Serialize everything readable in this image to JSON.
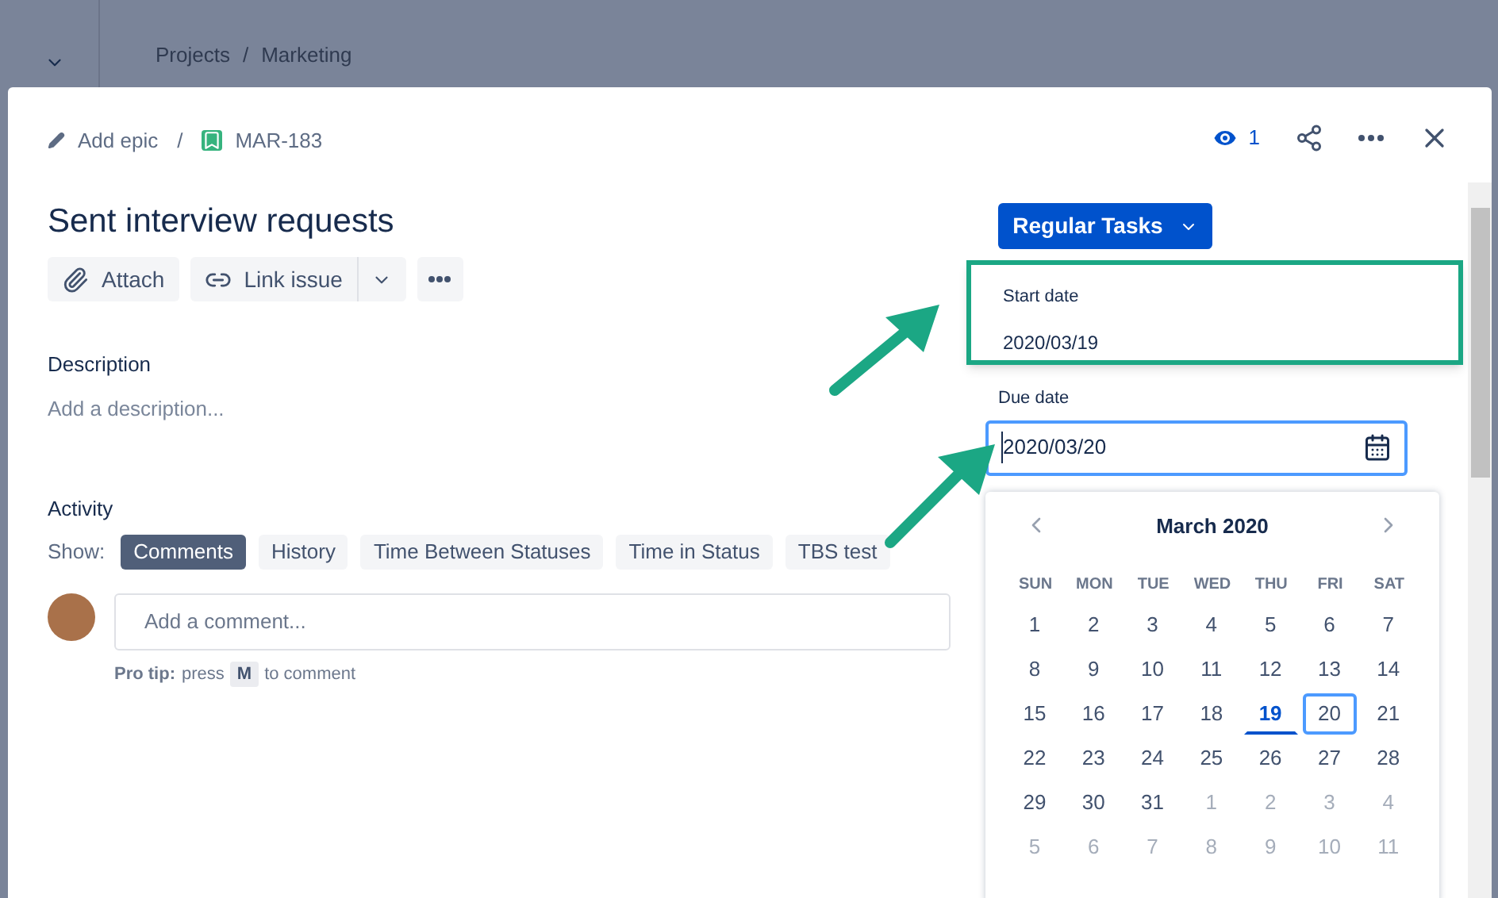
{
  "background": {
    "breadcrumb": [
      "Projects",
      "Marketing"
    ],
    "separator": "/"
  },
  "header": {
    "epic": "Add epic",
    "separator": "/",
    "issue_key": "MAR-183",
    "watchers": "1"
  },
  "issue": {
    "title": "Sent interview requests",
    "actions": [
      "Attach",
      "Link issue"
    ]
  },
  "description": {
    "label": "Description",
    "placeholder": "Add a description..."
  },
  "activity": {
    "label": "Activity",
    "show_label": "Show:",
    "tabs": [
      {
        "label": "Comments",
        "selected": true
      },
      {
        "label": "History",
        "selected": false
      },
      {
        "label": "Time Between Statuses",
        "selected": false
      },
      {
        "label": "Time in Status",
        "selected": false
      },
      {
        "label": "TBS test",
        "selected": false
      }
    ],
    "comment_placeholder": "Add a comment...",
    "tip_label": "Pro tip:",
    "tip_before": "press",
    "tip_key": "M",
    "tip_after": "to comment"
  },
  "status_button": "Regular Tasks",
  "start_date": {
    "label": "Start date",
    "value": "2020/03/19",
    "highlighted": true
  },
  "due_date": {
    "label": "Due date",
    "value": "2020/03/20"
  },
  "calendar": {
    "month": "March 2020",
    "weekdays": [
      "SUN",
      "MON",
      "TUE",
      "WED",
      "THU",
      "FRI",
      "SAT"
    ],
    "days": [
      {
        "label": "1",
        "kind": "current",
        "selected": false
      },
      {
        "label": "2",
        "kind": "current",
        "selected": false
      },
      {
        "label": "3",
        "kind": "current",
        "selected": false
      },
      {
        "label": "4",
        "kind": "current",
        "selected": false
      },
      {
        "label": "5",
        "kind": "current",
        "selected": false
      },
      {
        "label": "6",
        "kind": "current",
        "selected": false
      },
      {
        "label": "7",
        "kind": "current",
        "selected": false
      },
      {
        "label": "8",
        "kind": "current",
        "selected": false
      },
      {
        "label": "9",
        "kind": "current",
        "selected": false
      },
      {
        "label": "10",
        "kind": "current",
        "selected": false
      },
      {
        "label": "11",
        "kind": "current",
        "selected": false
      },
      {
        "label": "12",
        "kind": "current",
        "selected": false
      },
      {
        "label": "13",
        "kind": "current",
        "selected": false
      },
      {
        "label": "14",
        "kind": "current",
        "selected": false
      },
      {
        "label": "15",
        "kind": "current",
        "selected": false
      },
      {
        "label": "16",
        "kind": "current",
        "selected": false
      },
      {
        "label": "17",
        "kind": "current",
        "selected": false
      },
      {
        "label": "18",
        "kind": "current",
        "selected": false
      },
      {
        "label": "19",
        "kind": "today",
        "selected": false
      },
      {
        "label": "20",
        "kind": "current",
        "selected": true
      },
      {
        "label": "21",
        "kind": "current",
        "selected": false
      },
      {
        "label": "22",
        "kind": "current",
        "selected": false
      },
      {
        "label": "23",
        "kind": "current",
        "selected": false
      },
      {
        "label": "24",
        "kind": "current",
        "selected": false
      },
      {
        "label": "25",
        "kind": "current",
        "selected": false
      },
      {
        "label": "26",
        "kind": "current",
        "selected": false
      },
      {
        "label": "27",
        "kind": "current",
        "selected": false
      },
      {
        "label": "28",
        "kind": "current",
        "selected": false
      },
      {
        "label": "29",
        "kind": "current",
        "selected": false
      },
      {
        "label": "30",
        "kind": "current",
        "selected": false
      },
      {
        "label": "31",
        "kind": "current",
        "selected": false
      },
      {
        "label": "1",
        "kind": "other",
        "selected": false
      },
      {
        "label": "2",
        "kind": "other",
        "selected": false
      },
      {
        "label": "3",
        "kind": "other",
        "selected": false
      },
      {
        "label": "4",
        "kind": "other",
        "selected": false
      },
      {
        "label": "5",
        "kind": "other",
        "selected": false
      },
      {
        "label": "6",
        "kind": "other",
        "selected": false
      },
      {
        "label": "7",
        "kind": "other",
        "selected": false
      },
      {
        "label": "8",
        "kind": "other",
        "selected": false
      },
      {
        "label": "9",
        "kind": "other",
        "selected": false
      },
      {
        "label": "10",
        "kind": "other",
        "selected": false
      },
      {
        "label": "11",
        "kind": "other",
        "selected": false
      }
    ]
  }
}
